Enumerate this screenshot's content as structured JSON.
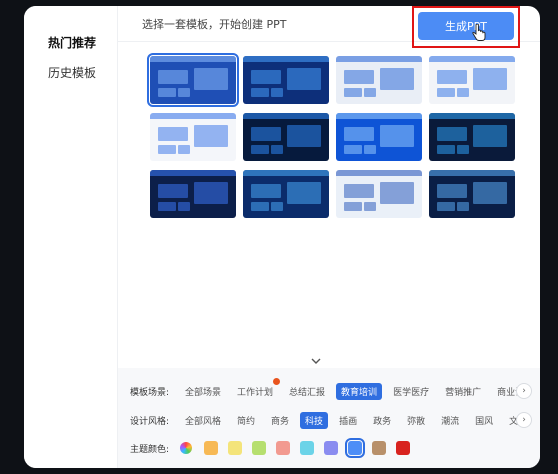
{
  "sidebar": {
    "items": [
      {
        "label": "热门推荐",
        "active": true
      },
      {
        "label": "历史模板",
        "active": false
      }
    ]
  },
  "header": {
    "prompt": "选择一套模板，开始创建 PPT",
    "generate_label": "生成PPT"
  },
  "templates": {
    "selected_index": 0,
    "items": [
      {
        "bg": "#1f4fb5",
        "accent": "#8fc0ff"
      },
      {
        "bg": "#0d2f7a",
        "accent": "#4aa3ff"
      },
      {
        "bg": "#e9eef6",
        "accent": "#1f5fd6"
      },
      {
        "bg": "#f2f4f8",
        "accent": "#2a6de3"
      },
      {
        "bg": "#f4f6fa",
        "accent": "#3170e8"
      },
      {
        "bg": "#061a3d",
        "accent": "#2f8cff"
      },
      {
        "bg": "#0e54d6",
        "accent": "#9cd0ff"
      },
      {
        "bg": "#0a1a3a",
        "accent": "#2fa8ff"
      },
      {
        "bg": "#0c1f4a",
        "accent": "#3d7cff"
      },
      {
        "bg": "#0b2c6b",
        "accent": "#4db0ff"
      },
      {
        "bg": "#eaf0f8",
        "accent": "#1e4fb8"
      },
      {
        "bg": "#0a1e46",
        "accent": "#5fb3ff"
      }
    ]
  },
  "filters": {
    "scene": {
      "label": "模板场景:",
      "options": [
        "全部场景",
        "工作计划",
        "总结汇报",
        "教育培训",
        "医学医疗",
        "营销推广",
        "商业计"
      ],
      "active": "教育培训",
      "hot": "工作计划"
    },
    "style": {
      "label": "设计风格:",
      "options": [
        "全部风格",
        "简约",
        "商务",
        "科技",
        "插画",
        "政务",
        "弥散",
        "潮流",
        "国风",
        "文"
      ],
      "active": "科技"
    },
    "color": {
      "label": "主题颜色:",
      "swatches": [
        "#f7b955",
        "#f4e47a",
        "#b6df6f",
        "#f29a90",
        "#6bd3e8",
        "#8a8cf0",
        "#4e8ef7",
        "#b8906a",
        "#d8231f"
      ],
      "selected": "#4e8ef7"
    }
  },
  "icons": {
    "collapse": "chevron-down-icon",
    "next": "chevron-right-icon",
    "cursor": "hand-cursor-icon",
    "all_colors": "rainbow-circle-icon"
  }
}
